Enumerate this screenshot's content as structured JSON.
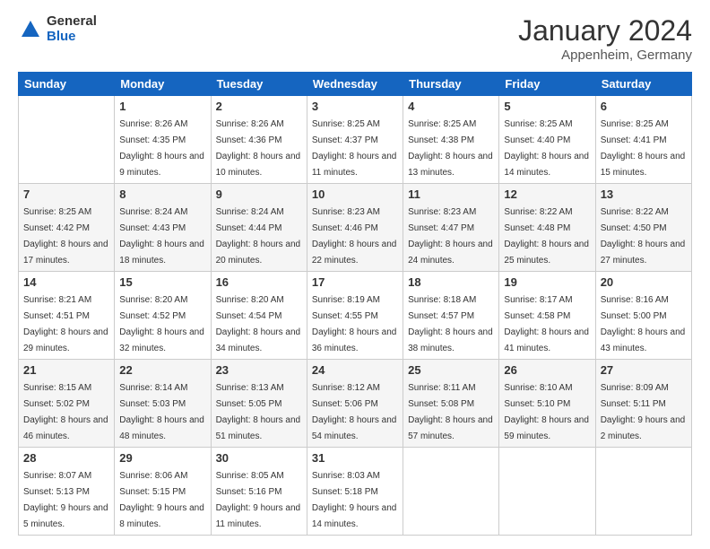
{
  "logo": {
    "general": "General",
    "blue": "Blue"
  },
  "header": {
    "month": "January 2024",
    "location": "Appenheim, Germany"
  },
  "weekdays": [
    "Sunday",
    "Monday",
    "Tuesday",
    "Wednesday",
    "Thursday",
    "Friday",
    "Saturday"
  ],
  "weeks": [
    [
      {
        "day": "",
        "sunrise": "",
        "sunset": "",
        "daylight": ""
      },
      {
        "day": "1",
        "sunrise": "Sunrise: 8:26 AM",
        "sunset": "Sunset: 4:35 PM",
        "daylight": "Daylight: 8 hours and 9 minutes."
      },
      {
        "day": "2",
        "sunrise": "Sunrise: 8:26 AM",
        "sunset": "Sunset: 4:36 PM",
        "daylight": "Daylight: 8 hours and 10 minutes."
      },
      {
        "day": "3",
        "sunrise": "Sunrise: 8:25 AM",
        "sunset": "Sunset: 4:37 PM",
        "daylight": "Daylight: 8 hours and 11 minutes."
      },
      {
        "day": "4",
        "sunrise": "Sunrise: 8:25 AM",
        "sunset": "Sunset: 4:38 PM",
        "daylight": "Daylight: 8 hours and 13 minutes."
      },
      {
        "day": "5",
        "sunrise": "Sunrise: 8:25 AM",
        "sunset": "Sunset: 4:40 PM",
        "daylight": "Daylight: 8 hours and 14 minutes."
      },
      {
        "day": "6",
        "sunrise": "Sunrise: 8:25 AM",
        "sunset": "Sunset: 4:41 PM",
        "daylight": "Daylight: 8 hours and 15 minutes."
      }
    ],
    [
      {
        "day": "7",
        "sunrise": "Sunrise: 8:25 AM",
        "sunset": "Sunset: 4:42 PM",
        "daylight": "Daylight: 8 hours and 17 minutes."
      },
      {
        "day": "8",
        "sunrise": "Sunrise: 8:24 AM",
        "sunset": "Sunset: 4:43 PM",
        "daylight": "Daylight: 8 hours and 18 minutes."
      },
      {
        "day": "9",
        "sunrise": "Sunrise: 8:24 AM",
        "sunset": "Sunset: 4:44 PM",
        "daylight": "Daylight: 8 hours and 20 minutes."
      },
      {
        "day": "10",
        "sunrise": "Sunrise: 8:23 AM",
        "sunset": "Sunset: 4:46 PM",
        "daylight": "Daylight: 8 hours and 22 minutes."
      },
      {
        "day": "11",
        "sunrise": "Sunrise: 8:23 AM",
        "sunset": "Sunset: 4:47 PM",
        "daylight": "Daylight: 8 hours and 24 minutes."
      },
      {
        "day": "12",
        "sunrise": "Sunrise: 8:22 AM",
        "sunset": "Sunset: 4:48 PM",
        "daylight": "Daylight: 8 hours and 25 minutes."
      },
      {
        "day": "13",
        "sunrise": "Sunrise: 8:22 AM",
        "sunset": "Sunset: 4:50 PM",
        "daylight": "Daylight: 8 hours and 27 minutes."
      }
    ],
    [
      {
        "day": "14",
        "sunrise": "Sunrise: 8:21 AM",
        "sunset": "Sunset: 4:51 PM",
        "daylight": "Daylight: 8 hours and 29 minutes."
      },
      {
        "day": "15",
        "sunrise": "Sunrise: 8:20 AM",
        "sunset": "Sunset: 4:52 PM",
        "daylight": "Daylight: 8 hours and 32 minutes."
      },
      {
        "day": "16",
        "sunrise": "Sunrise: 8:20 AM",
        "sunset": "Sunset: 4:54 PM",
        "daylight": "Daylight: 8 hours and 34 minutes."
      },
      {
        "day": "17",
        "sunrise": "Sunrise: 8:19 AM",
        "sunset": "Sunset: 4:55 PM",
        "daylight": "Daylight: 8 hours and 36 minutes."
      },
      {
        "day": "18",
        "sunrise": "Sunrise: 8:18 AM",
        "sunset": "Sunset: 4:57 PM",
        "daylight": "Daylight: 8 hours and 38 minutes."
      },
      {
        "day": "19",
        "sunrise": "Sunrise: 8:17 AM",
        "sunset": "Sunset: 4:58 PM",
        "daylight": "Daylight: 8 hours and 41 minutes."
      },
      {
        "day": "20",
        "sunrise": "Sunrise: 8:16 AM",
        "sunset": "Sunset: 5:00 PM",
        "daylight": "Daylight: 8 hours and 43 minutes."
      }
    ],
    [
      {
        "day": "21",
        "sunrise": "Sunrise: 8:15 AM",
        "sunset": "Sunset: 5:02 PM",
        "daylight": "Daylight: 8 hours and 46 minutes."
      },
      {
        "day": "22",
        "sunrise": "Sunrise: 8:14 AM",
        "sunset": "Sunset: 5:03 PM",
        "daylight": "Daylight: 8 hours and 48 minutes."
      },
      {
        "day": "23",
        "sunrise": "Sunrise: 8:13 AM",
        "sunset": "Sunset: 5:05 PM",
        "daylight": "Daylight: 8 hours and 51 minutes."
      },
      {
        "day": "24",
        "sunrise": "Sunrise: 8:12 AM",
        "sunset": "Sunset: 5:06 PM",
        "daylight": "Daylight: 8 hours and 54 minutes."
      },
      {
        "day": "25",
        "sunrise": "Sunrise: 8:11 AM",
        "sunset": "Sunset: 5:08 PM",
        "daylight": "Daylight: 8 hours and 57 minutes."
      },
      {
        "day": "26",
        "sunrise": "Sunrise: 8:10 AM",
        "sunset": "Sunset: 5:10 PM",
        "daylight": "Daylight: 8 hours and 59 minutes."
      },
      {
        "day": "27",
        "sunrise": "Sunrise: 8:09 AM",
        "sunset": "Sunset: 5:11 PM",
        "daylight": "Daylight: 9 hours and 2 minutes."
      }
    ],
    [
      {
        "day": "28",
        "sunrise": "Sunrise: 8:07 AM",
        "sunset": "Sunset: 5:13 PM",
        "daylight": "Daylight: 9 hours and 5 minutes."
      },
      {
        "day": "29",
        "sunrise": "Sunrise: 8:06 AM",
        "sunset": "Sunset: 5:15 PM",
        "daylight": "Daylight: 9 hours and 8 minutes."
      },
      {
        "day": "30",
        "sunrise": "Sunrise: 8:05 AM",
        "sunset": "Sunset: 5:16 PM",
        "daylight": "Daylight: 9 hours and 11 minutes."
      },
      {
        "day": "31",
        "sunrise": "Sunrise: 8:03 AM",
        "sunset": "Sunset: 5:18 PM",
        "daylight": "Daylight: 9 hours and 14 minutes."
      },
      {
        "day": "",
        "sunrise": "",
        "sunset": "",
        "daylight": ""
      },
      {
        "day": "",
        "sunrise": "",
        "sunset": "",
        "daylight": ""
      },
      {
        "day": "",
        "sunrise": "",
        "sunset": "",
        "daylight": ""
      }
    ]
  ]
}
